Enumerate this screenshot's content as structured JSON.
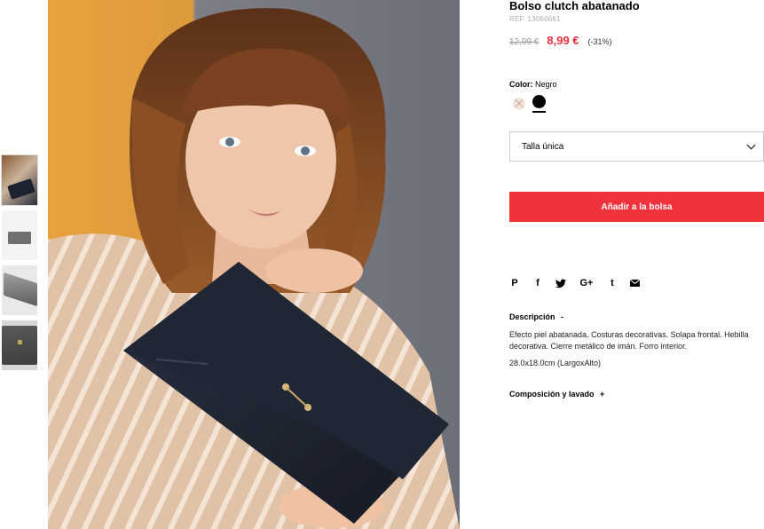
{
  "product": {
    "title": "Bolso clutch abatanado",
    "ref": "REF. 13060661",
    "old_price": "12,99 €",
    "new_price": "8,99 €",
    "discount": "(-31%)",
    "color_label": "Color:",
    "color_value": "Negro",
    "swatches": [
      "nude",
      "black"
    ],
    "selected_swatch": "black",
    "size_value": "Talla única",
    "add_button": "Añadir a la bolsa"
  },
  "share_icons": [
    "pinterest-icon",
    "facebook-icon",
    "twitter-icon",
    "google-plus-icon",
    "tumblr-icon",
    "email-icon"
  ],
  "share_glyphs": {
    "pinterest": "P",
    "facebook": "f",
    "google_plus": "G+",
    "tumblr": "t"
  },
  "description": {
    "heading": "Descripción",
    "toggle": "-",
    "body": "Efecto piel abatanada. Costuras decorativas. Solapa frontal. Hebilla decorativa. Cierre metálico de imán. Forro interior.",
    "dimensions": "28.0x18.0cm (LargoxAlto)"
  },
  "composition": {
    "heading": "Composición y lavado",
    "toggle": "+"
  },
  "colors": {
    "accent": "#f0323c",
    "sale_price": "#e8313a"
  }
}
